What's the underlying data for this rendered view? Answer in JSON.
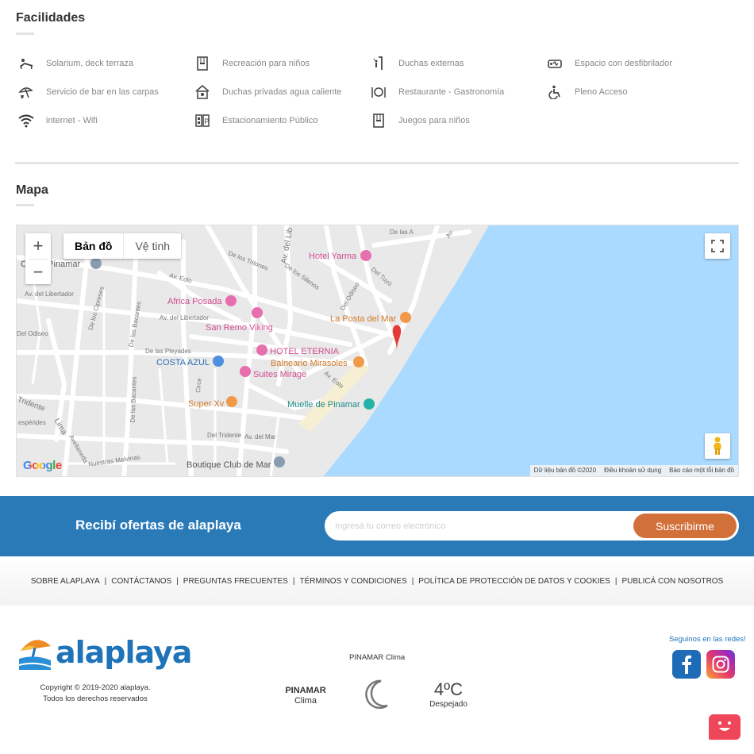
{
  "facilities": {
    "title": "Facilidades",
    "items": [
      {
        "label": "Solarium, deck terraza",
        "icon": "sunbed-icon"
      },
      {
        "label": "Recreación para niños",
        "icon": "kids-frame-icon"
      },
      {
        "label": "Duchas externas",
        "icon": "shower-icon"
      },
      {
        "label": "Espacio con desfibrilador",
        "icon": "defibrillator-icon"
      },
      {
        "label": "Servicio de bar en las carpas",
        "icon": "umbrella-drink-icon"
      },
      {
        "label": "Duchas privadas agua caliente",
        "icon": "hot-shower-icon"
      },
      {
        "label": "Restaurante - Gastronomía",
        "icon": "cutlery-icon"
      },
      {
        "label": "Pleno Acceso",
        "icon": "wheelchair-icon"
      },
      {
        "label": "internet - Wifi",
        "icon": "wifi-icon"
      },
      {
        "label": "Estacionamiento Público",
        "icon": "parking-icon"
      },
      {
        "label": "Juegos para niños",
        "icon": "playground-icon"
      }
    ]
  },
  "map": {
    "title": "Mapa",
    "tabs": [
      "Bản đồ",
      "Vệ tinh"
    ],
    "zoom_in": "+",
    "zoom_out": "−",
    "google": "Google",
    "attribution": [
      "Dữ liệu bản đồ ©2020",
      "Điều khoản sử dụng",
      "Báo cáo một lỗi bản đồ"
    ],
    "pois": {
      "hotel_yarma": "Hotel Yarma",
      "africa_posada": "Africa Posada",
      "san_remo": "San Remo Viking",
      "hotel_eternia": "HOTEL ETERNIA",
      "la_posta": "La Posta del Mar",
      "balneario": "Balneario Mirasoles",
      "costa_azul": "COSTA AZUL",
      "suites_mirage": "Suites Mirage",
      "super_xv": "Super Xv",
      "muelle": "Muelle de Pinamar",
      "boutique": "Boutique Club de Mar",
      "centro": "Ce",
      "pinamar": "e Pinamar"
    },
    "streets": {
      "libertador1": "Av. del Libertador",
      "libertador2": "Av. del Libertador",
      "eolo1": "Av. Eolo",
      "eolo2": "Av. Eolo",
      "tritones": "De los Tritones",
      "silentos": "De los Silenos",
      "odiseo1": "Del Odiseo",
      "odiseo2": "Del Odiseo",
      "tuyu": "Del Tuyú",
      "cipreses": "De los Cipreses",
      "bacantes1": "De las Bacantes",
      "bacantes2": "De las Bacantes",
      "pleyades": "De las Pleyades",
      "circe": "Circe",
      "tridente1": "Tridente",
      "tridente2": "Del Tridente",
      "hesperides": "espérides",
      "lima": "Lima",
      "avmar": "Av. del Mar",
      "avellaneda": "Avellaneda",
      "malvinas": "Nuestras Malvinas",
      "avlib": "Av. del Lib",
      "lasa": "De las A",
      "avr": "Av."
    }
  },
  "newsletter": {
    "title": "Recibí ofertas de alaplaya",
    "placeholder": "Ingresá tu correo electrónico",
    "button": "Suscribirme"
  },
  "footer_links": [
    "SOBRE ALAPLAYA",
    "CONTÁCTANOS",
    "PREGUNTAS FRECUENTES",
    "TÉRMINOS Y CONDICIONES",
    "POLÍTICA DE PROTECCIÓN DE DATOS Y COOKIES",
    "PUBLICÁ CON NOSOTROS"
  ],
  "footer": {
    "logo_text": "alaplaya",
    "copyright_line1": "Copyright © 2019-2020 alaplaya.",
    "copyright_line2": "Todos los derechos reservados",
    "weather_title": "PINAMAR Clima",
    "weather_city": "PINAMAR",
    "weather_city_sub": "Clima",
    "weather_temp": "4ºC",
    "weather_desc": "Despejado",
    "social_title": "Seguinos en las redes!"
  },
  "colors": {
    "newsletter_bg": "#2a7ab8",
    "button_orange": "#d2703a",
    "sea": "#aadaff",
    "brand_blue": "#1e73b9"
  }
}
